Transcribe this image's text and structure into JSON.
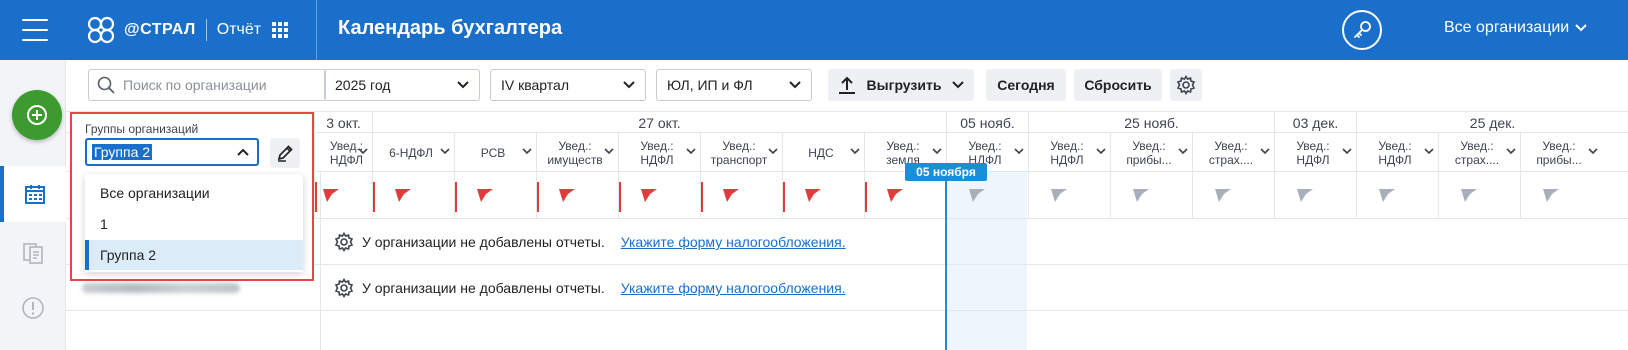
{
  "header": {
    "logo_text": "@СТРАЛ",
    "product": "Отчёт",
    "title": "Календарь бухгалтера",
    "org_selector": "Все организации"
  },
  "toolbar": {
    "search_placeholder": "Поиск по организации",
    "year": "2025 год",
    "quarter": "IV квартал",
    "org_type": "ЮЛ, ИП и ФЛ",
    "export_label": "Выгрузить",
    "today_label": "Сегодня",
    "reset_label": "Сбросить"
  },
  "groups": {
    "label": "Группы организаций",
    "selected": "Группа 2",
    "options": [
      "Все организации",
      "1",
      "Группа 2"
    ]
  },
  "calendar": {
    "dates": [
      "3 окт.",
      "27 окт.",
      "05 нояб.",
      "25 нояб.",
      "03 дек.",
      "25 дек."
    ],
    "reports": [
      [
        "Увед.:",
        "НДФЛ"
      ],
      [
        "6-НДФЛ",
        ""
      ],
      [
        "РСВ",
        ""
      ],
      [
        "Увед.:",
        "имуществ"
      ],
      [
        "Увед.:",
        "НДФЛ"
      ],
      [
        "Увед.:",
        "транспорт"
      ],
      [
        "НДС",
        ""
      ],
      [
        "Увед.:",
        "земля"
      ],
      [
        "Увед.:",
        "НДФЛ"
      ],
      [
        "Увед.:",
        "НДФЛ"
      ],
      [
        "Увед.:",
        "прибы..."
      ],
      [
        "Увед.:",
        "страх...."
      ],
      [
        "Увед.:",
        "НДФЛ"
      ],
      [
        "Увед.:",
        "НДФЛ"
      ],
      [
        "Увед.:",
        "страх...."
      ],
      [
        "Увед.:",
        "прибы..."
      ]
    ],
    "today_badge": "05 ноября",
    "messages": [
      {
        "text": "У организации не добавлены отчеты.",
        "link": "Укажите форму налогообложения."
      },
      {
        "text": "У организации не добавлены отчеты.",
        "link": "Укажите форму налогообложения."
      }
    ]
  },
  "colors": {
    "brand": "#1a6fcb",
    "add_button": "#3c9a2e",
    "overdue": "#e23b3b",
    "pending": "#a7b0ba",
    "highlight_border": "#e84545"
  }
}
